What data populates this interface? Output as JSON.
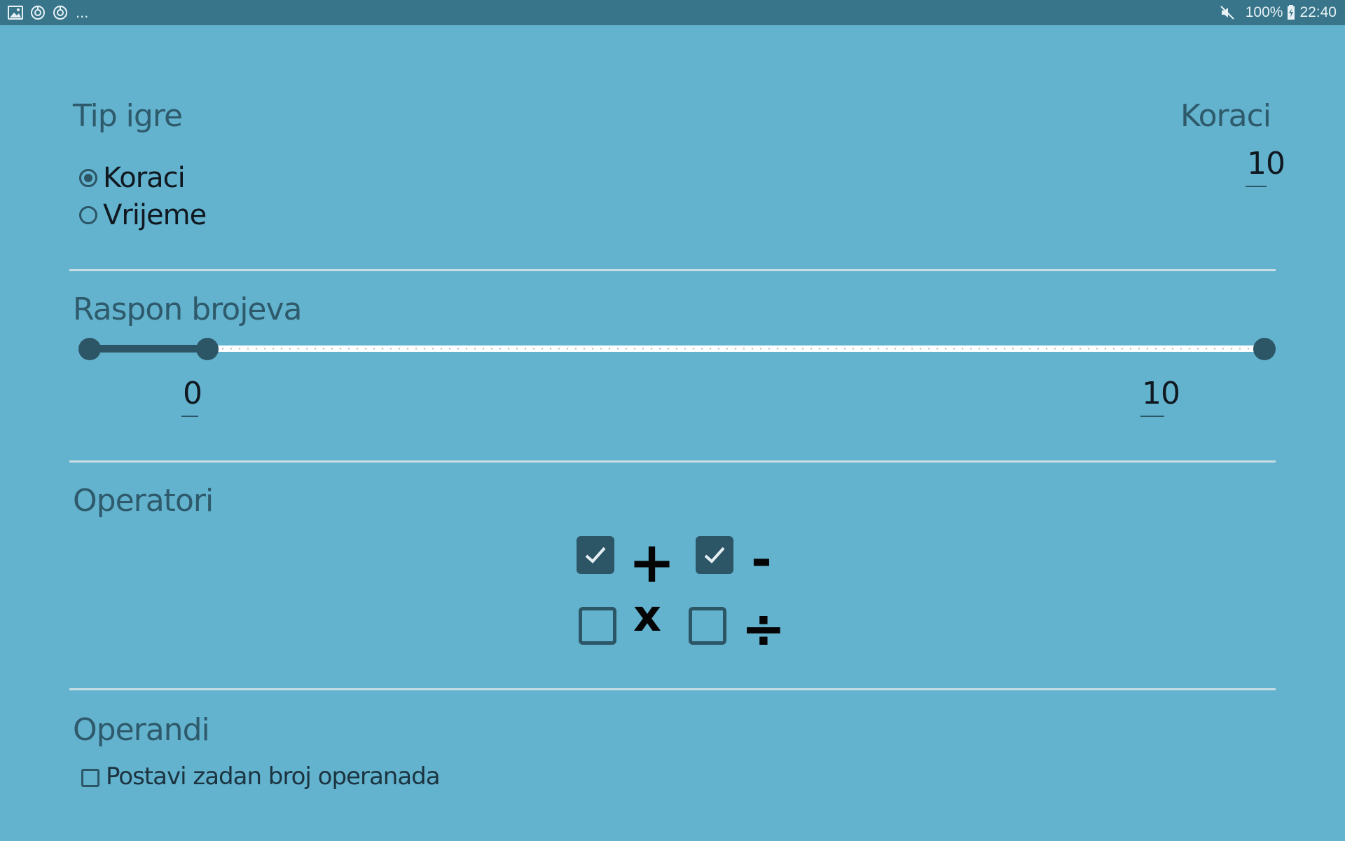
{
  "status_bar": {
    "left_icons": [
      "image-icon",
      "sync-icon",
      "sync-icon"
    ],
    "dots": "...",
    "battery": "100%",
    "time": "22:40"
  },
  "game_type": {
    "title": "Tip igre",
    "options": [
      {
        "label": "Koraci",
        "checked": true
      },
      {
        "label": "Vrijeme",
        "checked": false
      }
    ]
  },
  "steps": {
    "title": "Koraci",
    "value": "10"
  },
  "number_range": {
    "title": "Raspon brojeva",
    "min_value": "0",
    "max_value": "10"
  },
  "operators": {
    "title": "Operatori",
    "items": [
      {
        "sign": "+",
        "checked": true
      },
      {
        "sign": "-",
        "checked": true
      },
      {
        "sign": "x",
        "checked": false
      },
      {
        "sign": "÷",
        "checked": false
      }
    ]
  },
  "operands": {
    "title": "Operandi",
    "checkbox_label": "Postavi zadan broj operanada",
    "checked": false
  }
}
